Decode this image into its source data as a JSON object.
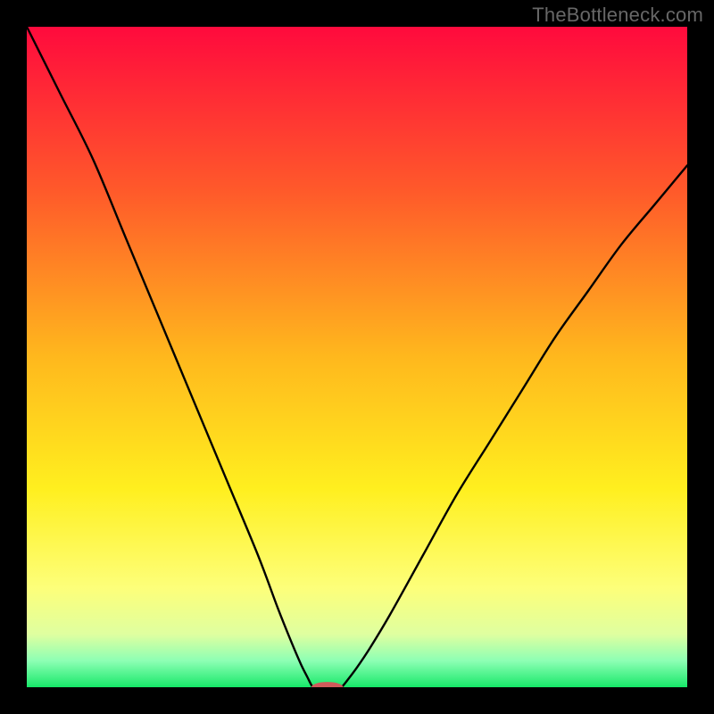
{
  "watermark": "TheBottleneck.com",
  "chart_data": {
    "type": "line",
    "title": "",
    "xlabel": "",
    "ylabel": "",
    "xlim": [
      0,
      100
    ],
    "ylim": [
      0,
      100
    ],
    "grid": false,
    "legend": false,
    "background_gradient": {
      "stops": [
        {
          "pos": 0.0,
          "color": "#ff0a3d"
        },
        {
          "pos": 0.25,
          "color": "#ff5a2a"
        },
        {
          "pos": 0.5,
          "color": "#ffb81d"
        },
        {
          "pos": 0.7,
          "color": "#ffef1f"
        },
        {
          "pos": 0.85,
          "color": "#fdff7a"
        },
        {
          "pos": 0.92,
          "color": "#dfffa0"
        },
        {
          "pos": 0.96,
          "color": "#8dffb4"
        },
        {
          "pos": 1.0,
          "color": "#18e86a"
        }
      ]
    },
    "curves": [
      {
        "name": "left-branch",
        "x": [
          0,
          5,
          10,
          15,
          20,
          25,
          30,
          35,
          38,
          40,
          41.5,
          42.5,
          43,
          43.3
        ],
        "y": [
          100,
          90,
          80,
          68,
          56,
          44,
          32,
          20,
          12,
          7,
          3.5,
          1.5,
          0.5,
          0
        ]
      },
      {
        "name": "right-branch",
        "x": [
          47.7,
          48.5,
          50,
          52,
          55,
          60,
          65,
          70,
          75,
          80,
          85,
          90,
          95,
          100
        ],
        "y": [
          0,
          1,
          3,
          6,
          11,
          20,
          29,
          37,
          45,
          53,
          60,
          67,
          73,
          79
        ]
      }
    ],
    "marker": {
      "cx": 45.5,
      "cy": 0,
      "rx": 2.4,
      "ry": 0.8,
      "color": "#cf5a5a"
    },
    "baseline": {
      "x1": 0,
      "x2": 100,
      "y": 0,
      "color": "#18e86a"
    },
    "curve_stroke": "#000000",
    "curve_width": 2.4
  }
}
